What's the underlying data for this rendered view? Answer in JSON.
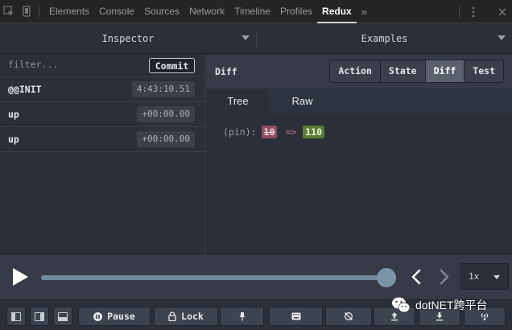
{
  "devtools": {
    "tabs": [
      "Elements",
      "Console",
      "Sources",
      "Network",
      "Timeline",
      "Profiles",
      "Redux"
    ],
    "active_tab": "Redux",
    "more_symbol": "»"
  },
  "monitor": {
    "left_selector": "Inspector",
    "right_selector": "Examples"
  },
  "action_list": {
    "filter_placeholder": "filter...",
    "commit_label": "Commit",
    "actions": [
      {
        "name": "@@INIT",
        "time": "4:43:10.51"
      },
      {
        "name": "up",
        "time": "+00:00.00"
      },
      {
        "name": "up",
        "time": "+00:00.00"
      }
    ]
  },
  "inspector": {
    "title": "Diff",
    "tabs": [
      "Action",
      "State",
      "Diff",
      "Test"
    ],
    "active_tab": "Diff",
    "view_tabs": [
      "Tree",
      "Raw"
    ],
    "active_view": "Tree",
    "diff": {
      "key": "(pin):",
      "old_value": "10",
      "arrow": "=>",
      "new_value": "110"
    }
  },
  "slider": {
    "progress": 1.0,
    "speed": "1x"
  },
  "toolbar": {
    "pause_label": "Pause",
    "lock_label": "Lock"
  },
  "watermark": {
    "text": "dotNET跨平台"
  },
  "colors": {
    "background": "#2a2f3a",
    "header": "#363b47",
    "diff_removed": "#8e4d63",
    "diff_added": "#5a7a3a",
    "slider_track": "#6f8b99"
  }
}
